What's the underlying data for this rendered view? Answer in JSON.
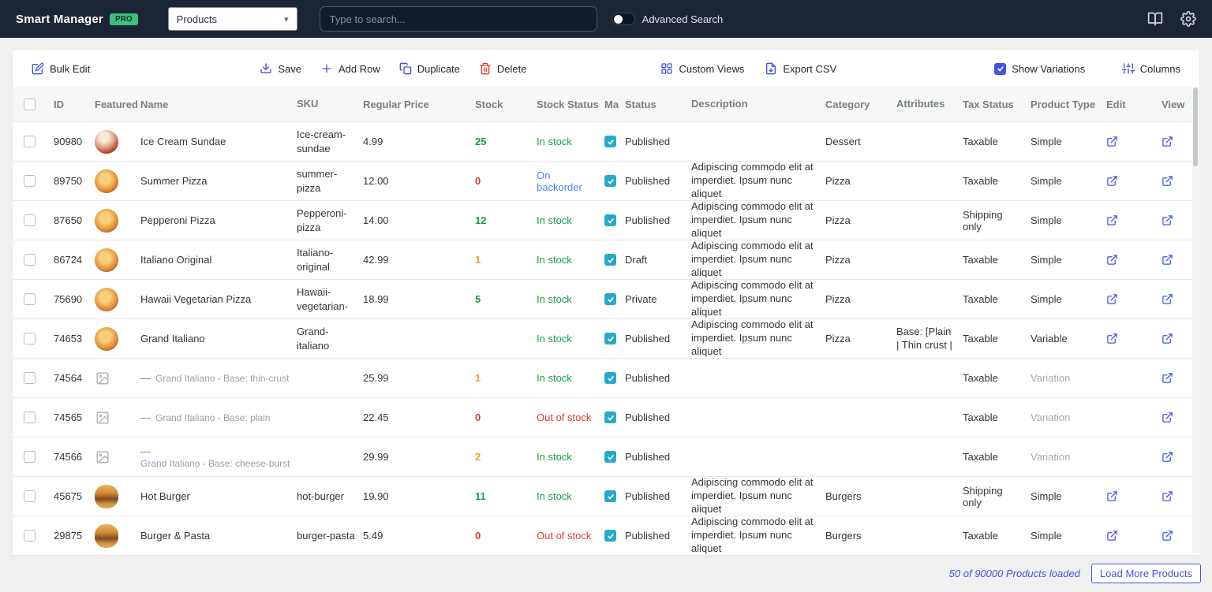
{
  "colors": {
    "topbar_bg": "#1c2534",
    "accent": "#4353df",
    "check_teal": "#28a9c9",
    "green": "#1a9e45",
    "red": "#e23b30",
    "orange": "#efa02f",
    "blue": "#4a86f7",
    "badge_green": "#3fbd82"
  },
  "topbar": {
    "brand": "Smart Manager",
    "badge": "PRO",
    "dashboard_select": "Products",
    "search_placeholder": "Type to search...",
    "advanced_search_label": "Advanced Search"
  },
  "toolbar": {
    "bulk_edit": "Bulk Edit",
    "save": "Save",
    "add_row": "Add Row",
    "duplicate": "Duplicate",
    "delete": "Delete",
    "custom_views": "Custom Views",
    "export_csv": "Export CSV",
    "show_variations": "Show Variations",
    "columns": "Columns"
  },
  "table": {
    "headers": {
      "id": "ID",
      "featured": "Featured",
      "name": "Name",
      "sku": "SKU",
      "price": "Regular Price",
      "stock": "Stock",
      "stock_status": "Stock Status",
      "manage": "Ma",
      "status": "Status",
      "description": "Description",
      "category": "Category",
      "attributes": "Attributes",
      "tax": "Tax Status",
      "type": "Product Type",
      "edit": "Edit",
      "view": "View"
    },
    "rows": [
      {
        "id": "90980",
        "thumb": "icecream",
        "name": "Ice Cream Sundae",
        "variation": false,
        "sku": "Ice-cream-sundae",
        "price": "4.99",
        "stock": "25",
        "stock_color": "green",
        "stock_status": "In stock",
        "stock_status_color": "green",
        "manage_stock": true,
        "status": "Published",
        "description": "",
        "category": "Dessert",
        "attributes": "",
        "tax": "Taxable",
        "type": "Simple",
        "has_edit": true,
        "has_view": true
      },
      {
        "id": "89750",
        "thumb": "pizza",
        "name": "Summer Pizza",
        "variation": false,
        "sku": "summer-pizza",
        "price": "12.00",
        "stock": "0",
        "stock_color": "red",
        "stock_status": "On backorder",
        "stock_status_color": "blue",
        "manage_stock": true,
        "status": "Published",
        "description": "Adipiscing commodo elit at imperdiet. Ipsum nunc aliquet",
        "category": "Pizza",
        "attributes": "",
        "tax": "Taxable",
        "type": "Simple",
        "has_edit": true,
        "has_view": true
      },
      {
        "id": "87650",
        "thumb": "pizza",
        "name": "Pepperoni Pizza",
        "variation": false,
        "sku": "Pepperoni-pizza",
        "price": "14.00",
        "stock": "12",
        "stock_color": "green",
        "stock_status": "In stock",
        "stock_status_color": "green",
        "manage_stock": true,
        "status": "Published",
        "description": "Adipiscing commodo elit at imperdiet. Ipsum nunc aliquet",
        "category": "Pizza",
        "attributes": "",
        "tax": "Shipping only",
        "type": "Simple",
        "has_edit": true,
        "has_view": true
      },
      {
        "id": "86724",
        "thumb": "pizza",
        "name": "Italiano Original",
        "variation": false,
        "sku": "Italiano-original",
        "price": "42.99",
        "stock": "1",
        "stock_color": "orange",
        "stock_status": "In stock",
        "stock_status_color": "green",
        "manage_stock": true,
        "status": "Draft",
        "description": "Adipiscing commodo elit at imperdiet. Ipsum nunc aliquet",
        "category": "Pizza",
        "attributes": "",
        "tax": "Taxable",
        "type": "Simple",
        "has_edit": true,
        "has_view": true
      },
      {
        "id": "75690",
        "thumb": "pizza",
        "name": "Hawaii Vegetarian Pizza",
        "variation": false,
        "sku": "Hawaii-vegetarian-",
        "price": "18.99",
        "stock": "5",
        "stock_color": "green",
        "stock_status": "In stock",
        "stock_status_color": "green",
        "manage_stock": true,
        "status": "Private",
        "description": "Adipiscing commodo elit at imperdiet. Ipsum nunc aliquet",
        "category": "Pizza",
        "attributes": "",
        "tax": "Taxable",
        "type": "Simple",
        "has_edit": true,
        "has_view": true
      },
      {
        "id": "74653",
        "thumb": "pizza",
        "name": "Grand Italiano",
        "variation": false,
        "sku": "Grand-italiano",
        "price": "",
        "stock": "",
        "stock_color": "",
        "stock_status": "In stock",
        "stock_status_color": "green",
        "manage_stock": true,
        "status": "Published",
        "description": "Adipiscing commodo elit at imperdiet. Ipsum nunc aliquet",
        "category": "Pizza",
        "attributes": "Base: [Plain | Thin crust |",
        "tax": "Taxable",
        "type": "Variable",
        "has_edit": true,
        "has_view": true
      },
      {
        "id": "74564",
        "thumb": "placeholder",
        "name": "Grand Italiano - Base: thin-crust",
        "variation": true,
        "sku": "",
        "price": "25.99",
        "stock": "1",
        "stock_color": "orange",
        "stock_status": "In stock",
        "stock_status_color": "green",
        "manage_stock": true,
        "status": "Published",
        "description": "",
        "category": "",
        "attributes": "",
        "tax": "Taxable",
        "type": "Variation",
        "has_edit": false,
        "has_view": true
      },
      {
        "id": "74565",
        "thumb": "placeholder",
        "name": "Grand Italiano - Base: plain",
        "variation": true,
        "sku": "",
        "price": "22.45",
        "stock": "0",
        "stock_color": "red",
        "stock_status": "Out of stock",
        "stock_status_color": "red",
        "manage_stock": true,
        "status": "Published",
        "description": "",
        "category": "",
        "attributes": "",
        "tax": "Taxable",
        "type": "Variation",
        "has_edit": false,
        "has_view": true
      },
      {
        "id": "74566",
        "thumb": "placeholder",
        "name": "Grand Italiano - Base: cheese-burst",
        "variation": true,
        "sku": "",
        "price": "29.99",
        "stock": "2",
        "stock_color": "orange",
        "stock_status": "In stock",
        "stock_status_color": "green",
        "manage_stock": true,
        "status": "Published",
        "description": "",
        "category": "",
        "attributes": "",
        "tax": "Taxable",
        "type": "Variation",
        "has_edit": false,
        "has_view": true
      },
      {
        "id": "45675",
        "thumb": "burger",
        "name": "Hot Burger",
        "variation": false,
        "sku": "hot-burger",
        "price": "19.90",
        "stock": "11",
        "stock_color": "green",
        "stock_status": "In stock",
        "stock_status_color": "green",
        "manage_stock": true,
        "status": "Published",
        "description": "Adipiscing commodo elit at imperdiet. Ipsum nunc aliquet",
        "category": "Burgers",
        "attributes": "",
        "tax": "Shipping only",
        "type": "Simple",
        "has_edit": true,
        "has_view": true
      },
      {
        "id": "29875",
        "thumb": "burger",
        "name": "Burger & Pasta",
        "variation": false,
        "sku": "burger-pasta",
        "price": "5.49",
        "stock": "0",
        "stock_color": "red",
        "stock_status": "Out of stock",
        "stock_status_color": "red",
        "manage_stock": true,
        "status": "Published",
        "description": "Adipiscing commodo elit at imperdiet. Ipsum nunc aliquet",
        "category": "Burgers",
        "attributes": "",
        "tax": "Taxable",
        "type": "Simple",
        "has_edit": true,
        "has_view": true
      }
    ]
  },
  "footer": {
    "loaded": "50 of 90000 Products loaded",
    "load_more": "Load More Products"
  }
}
